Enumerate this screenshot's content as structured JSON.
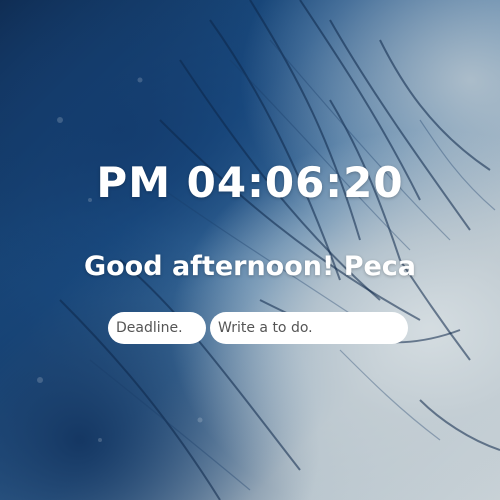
{
  "clock": {
    "time": "PM 04:06:20"
  },
  "greeting": {
    "text": "Good afternoon! Peca"
  },
  "todo_form": {
    "deadline_placeholder": "Deadline.",
    "todo_placeholder": "Write a to do."
  },
  "colors": {
    "text": "#ffffff",
    "input_background": "#ffffff",
    "background_dark": "#0f2c52",
    "background_light": "#c9d2d7"
  }
}
